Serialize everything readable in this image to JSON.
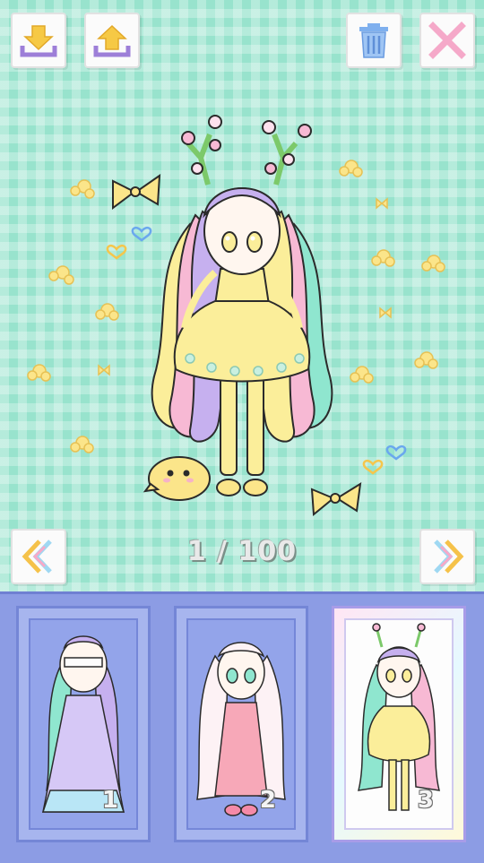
{
  "toolbar": {
    "save_icon": "download-tray-icon",
    "load_icon": "upload-tray-icon",
    "delete_icon": "trash-can-icon",
    "close_icon": "close-x-icon"
  },
  "pager": {
    "current": 1,
    "total": 100,
    "label": "1 / 100",
    "prev_icon": "double-chevron-left-icon",
    "next_icon": "double-chevron-right-icon"
  },
  "slots": [
    {
      "number": "1",
      "selected": false
    },
    {
      "number": "2",
      "selected": false
    },
    {
      "number": "3",
      "selected": true
    }
  ],
  "colors": {
    "background": "#98e3cd",
    "tray": "#8c9ce4",
    "dress": "#fbee9a",
    "hair_pink": "#f7b9d4",
    "hair_mint": "#8fe6cf",
    "hair_lilac": "#c6b0ef"
  }
}
